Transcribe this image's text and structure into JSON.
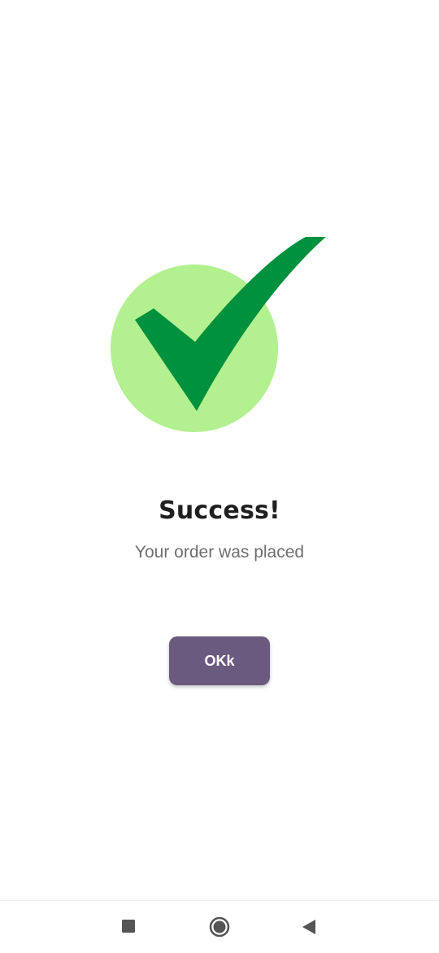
{
  "success": {
    "title": "Success!",
    "message": "Your order was placed",
    "button_label": "OKk"
  },
  "colors": {
    "circle": "#b3f08f",
    "checkmark": "#00913f",
    "button_bg": "#6b5a80",
    "button_text": "#ffffff",
    "title": "#1f1f1f",
    "message": "#6f6f6f"
  },
  "navigation_bar": {
    "icons": [
      "recents-square-icon",
      "home-circle-icon",
      "back-triangle-icon"
    ]
  }
}
